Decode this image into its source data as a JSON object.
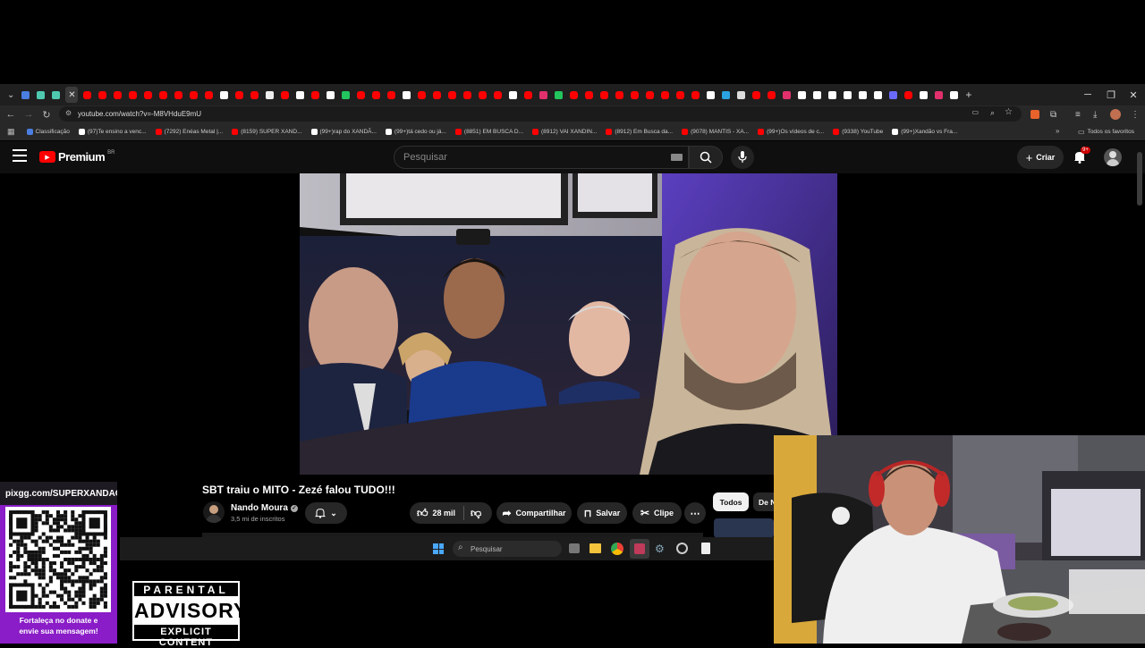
{
  "browser": {
    "url": "youtube.com/watch?v=-M8VHduE9mU",
    "bookmarks": [
      {
        "label": "Classificação",
        "color": "#4a7ee0"
      },
      {
        "label": "(97)Te ensino a venc...",
        "color": "#ffffff"
      },
      {
        "label": "(7292) Enéas Metal |...",
        "color": "#ff0000"
      },
      {
        "label": "(8159) SUPER XAND...",
        "color": "#ff0000"
      },
      {
        "label": "(99+)rap do XANDÃ...",
        "color": "#ffffff"
      },
      {
        "label": "(99+)tá cedo ou já...",
        "color": "#ffffff"
      },
      {
        "label": "(8851) EM BUSCA D...",
        "color": "#ff0000"
      },
      {
        "label": "(8912) VAI XANDIN...",
        "color": "#ff0000"
      },
      {
        "label": "(8912) Em Busca da...",
        "color": "#ff0000"
      },
      {
        "label": "(9078) MANTIS - XA...",
        "color": "#ff0000"
      },
      {
        "label": "(99+)Os vídeos de c...",
        "color": "#ff0000"
      },
      {
        "label": "(9338) YouTube",
        "color": "#ff0000"
      },
      {
        "label": "(99+)Xandão vs Fra...",
        "color": "#ffffff"
      }
    ],
    "all_bookmarks_label": "Todos os favoritos"
  },
  "youtube": {
    "logo_text": "Premium",
    "region": "BR",
    "search_placeholder": "Pesquisar",
    "create_label": "Criar",
    "notification_badge": "9+"
  },
  "video": {
    "title": "SBT traiu o MITO - Zezé falou TUDO!!!",
    "channel_name": "Nando Moura",
    "subscribers": "3,5 mi de inscritos",
    "likes": "28 mil",
    "share_label": "Compartilhar",
    "save_label": "Salvar",
    "clip_label": "Clipe"
  },
  "chips": {
    "all": "Todos",
    "next": "De N"
  },
  "taskbar": {
    "search_placeholder": "Pesquisar"
  },
  "overlay": {
    "pix_url": "pixgg.com/SUPERXANDAO",
    "pix_message_line1": "Fortaleça no donate e",
    "pix_message_line2": "envie sua mensagem!",
    "advisory_top": "PARENTAL",
    "advisory_mid": "ADVISORY",
    "advisory_bottom": "EXPLICIT CONTENT"
  },
  "colors": {
    "youtube_red": "#ff0000",
    "pix_purple": "#8a1dc7",
    "background": "#000000"
  }
}
